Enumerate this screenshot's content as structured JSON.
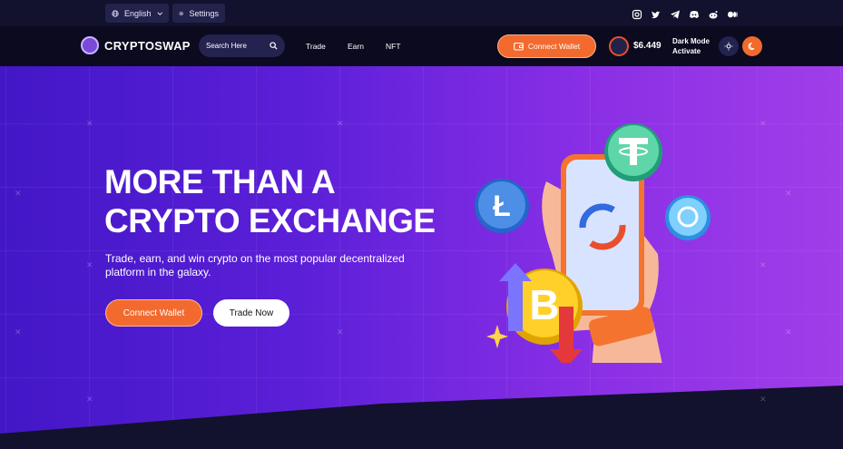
{
  "topbar": {
    "language": "English",
    "settings": "Settings",
    "socials": [
      "instagram-icon",
      "twitter-icon",
      "telegram-icon",
      "discord-icon",
      "reddit-icon",
      "medium-icon"
    ]
  },
  "nav": {
    "logo": "CRYPTOSWAP",
    "search_placeholder": "Search Here",
    "links": [
      "Trade",
      "Earn",
      "NFT"
    ],
    "connect_wallet": "Connect Wallet",
    "price": "$6.449",
    "dark_mode_line1": "Dark Mode",
    "dark_mode_line2": "Activate"
  },
  "hero": {
    "headline_line1": "MORE THAN A",
    "headline_line2": "CRYPTO EXCHANGE",
    "subtext": "Trade, earn, and win crypto on the most popular decentralized platform in the galaxy.",
    "connect_wallet": "Connect Wallet",
    "trade_now": "Trade Now"
  },
  "colors": {
    "accent": "#f26a2e",
    "hero_start": "#4217c6",
    "hero_end": "#a03ee8",
    "dark_bg": "#0b0a1f"
  }
}
